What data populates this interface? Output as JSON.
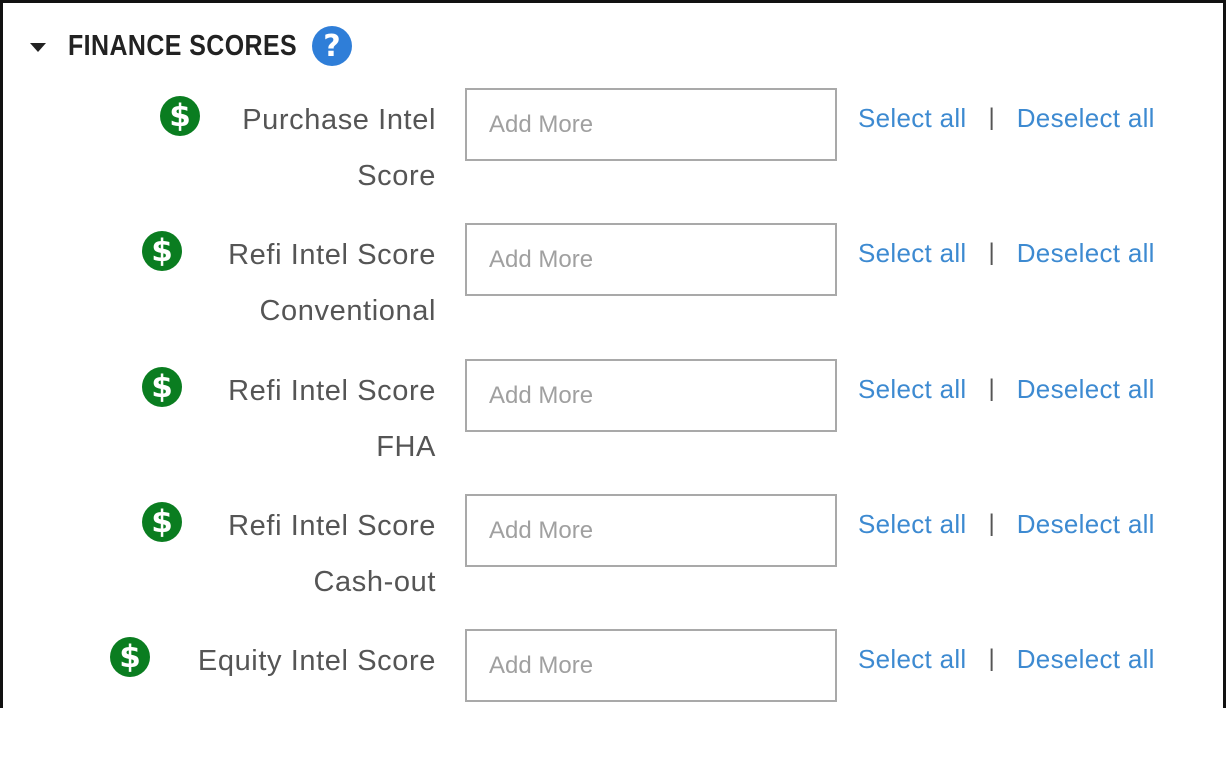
{
  "section": {
    "title": "FINANCE SCORES",
    "help_icon": "question-circle-icon",
    "help_glyph": "?",
    "collapse_icon": "caret-down-icon"
  },
  "colors": {
    "help_blue": "#2f7ed8",
    "dollar_green": "#0a7d20",
    "link_blue": "#3d8ad1"
  },
  "rows": [
    {
      "label_line1": "Purchase Intel",
      "label_line2": "Score",
      "icon": "dollar-icon",
      "glyph": "$",
      "placeholder": "Add More",
      "select_all": "Select all",
      "separator": "|",
      "deselect_all": "Deselect all"
    },
    {
      "label_line1": "Refi Intel Score",
      "label_line2": "Conventional",
      "icon": "dollar-icon",
      "glyph": "$",
      "placeholder": "Add More",
      "select_all": "Select all",
      "separator": "|",
      "deselect_all": "Deselect all"
    },
    {
      "label_line1": "Refi Intel Score",
      "label_line2": "FHA",
      "icon": "dollar-icon",
      "glyph": "$",
      "placeholder": "Add More",
      "select_all": "Select all",
      "separator": "|",
      "deselect_all": "Deselect all"
    },
    {
      "label_line1": "Refi Intel Score",
      "label_line2": "Cash-out",
      "icon": "dollar-icon",
      "glyph": "$",
      "placeholder": "Add More",
      "select_all": "Select all",
      "separator": "|",
      "deselect_all": "Deselect all"
    },
    {
      "label_line1": "Equity Intel Score",
      "label_line2": "",
      "icon": "dollar-icon",
      "glyph": "$",
      "placeholder": "Add More",
      "select_all": "Select all",
      "separator": "|",
      "deselect_all": "Deselect all"
    }
  ]
}
